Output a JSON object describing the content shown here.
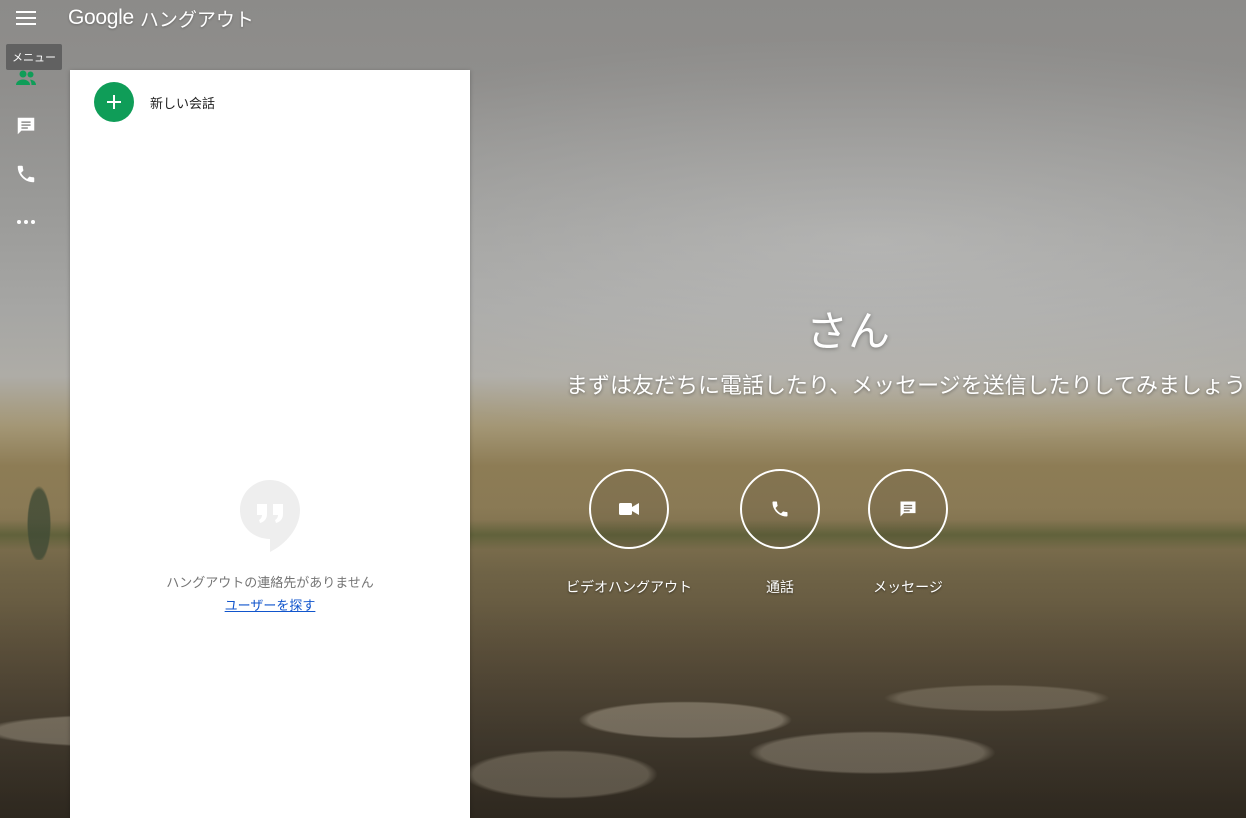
{
  "app": {
    "logo_google": "Google",
    "logo_product": "ハングアウト",
    "menu_tooltip": "メニュー"
  },
  "rail": {
    "items": [
      {
        "icon": "contacts-icon",
        "active": true
      },
      {
        "icon": "chat-icon",
        "active": false
      },
      {
        "icon": "phone-icon",
        "active": false
      },
      {
        "icon": "more-icon",
        "active": false
      }
    ]
  },
  "panel": {
    "new_conversation_label": "新しい会話",
    "empty_message": "ハングアウトの連絡先がありません",
    "find_users_link": "ユーザーを探す"
  },
  "hero": {
    "name_suffix": "さん",
    "subtitle": "まずは友だちに電話したり、メッセージを送信したりしてみましょう",
    "actions": [
      {
        "icon": "video-camera-icon",
        "label": "ビデオハングアウト"
      },
      {
        "icon": "phone-icon",
        "label": "通話"
      },
      {
        "icon": "message-icon",
        "label": "メッセージ"
      }
    ]
  },
  "colors": {
    "accent_green": "#0f9d58",
    "link_blue": "#15c",
    "tooltip_bg": "#616161"
  }
}
